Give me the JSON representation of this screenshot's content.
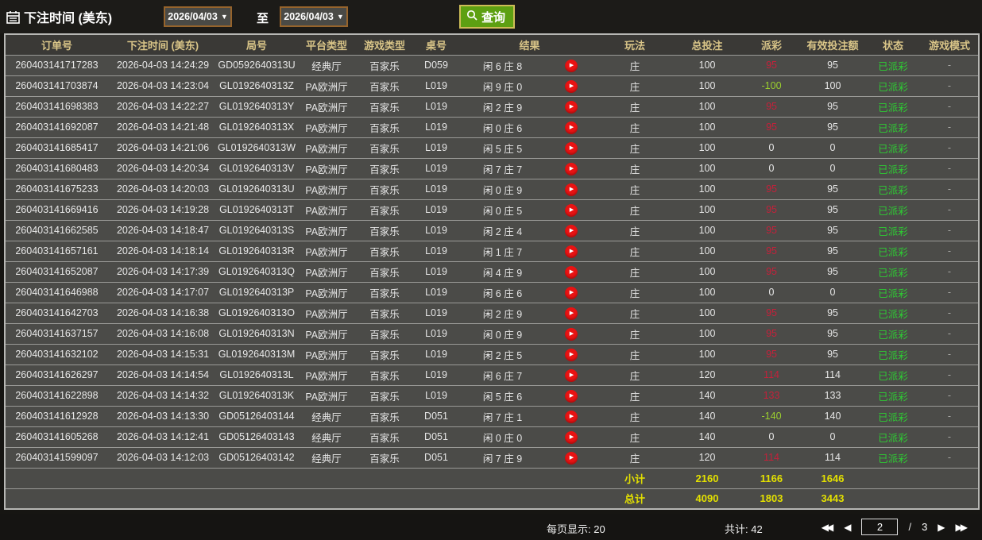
{
  "toolbar": {
    "label": "下注时间 (美东)",
    "date_from": "2026/04/03",
    "to_label": "至",
    "date_to": "2026/04/03",
    "search_label": "查询"
  },
  "table": {
    "columns": [
      "订单号",
      "下注时间 (美东)",
      "局号",
      "平台类型",
      "游戏类型",
      "桌号",
      "结果",
      "玩法",
      "总投注",
      "派彩",
      "有效投注额",
      "状态",
      "游戏模式"
    ],
    "rows": [
      {
        "order": "260403141717283",
        "time": "2026-04-03 14:24:29",
        "round": "GD0592640313U",
        "platform": "经典厅",
        "game": "百家乐",
        "table": "D059",
        "result": "闲 6 庄 8",
        "bet_type": "庄",
        "total": "100",
        "payout": "95",
        "payout_class": "payout-win",
        "valid": "95",
        "status": "已派彩",
        "mode": "-"
      },
      {
        "order": "260403141703874",
        "time": "2026-04-03 14:23:04",
        "round": "GL0192640313Z",
        "platform": "PA欧洲厅",
        "game": "百家乐",
        "table": "L019",
        "result": "闲 9 庄 0",
        "bet_type": "庄",
        "total": "100",
        "payout": "-100",
        "payout_class": "payout-loss",
        "valid": "100",
        "status": "已派彩",
        "mode": "-"
      },
      {
        "order": "260403141698383",
        "time": "2026-04-03 14:22:27",
        "round": "GL0192640313Y",
        "platform": "PA欧洲厅",
        "game": "百家乐",
        "table": "L019",
        "result": "闲 2 庄 9",
        "bet_type": "庄",
        "total": "100",
        "payout": "95",
        "payout_class": "payout-win",
        "valid": "95",
        "status": "已派彩",
        "mode": "-"
      },
      {
        "order": "260403141692087",
        "time": "2026-04-03 14:21:48",
        "round": "GL0192640313X",
        "platform": "PA欧洲厅",
        "game": "百家乐",
        "table": "L019",
        "result": "闲 0 庄 6",
        "bet_type": "庄",
        "total": "100",
        "payout": "95",
        "payout_class": "payout-win",
        "valid": "95",
        "status": "已派彩",
        "mode": "-"
      },
      {
        "order": "260403141685417",
        "time": "2026-04-03 14:21:06",
        "round": "GL0192640313W",
        "platform": "PA欧洲厅",
        "game": "百家乐",
        "table": "L019",
        "result": "闲 5 庄 5",
        "bet_type": "庄",
        "total": "100",
        "payout": "0",
        "payout_class": "payout-zero",
        "valid": "0",
        "status": "已派彩",
        "mode": "-"
      },
      {
        "order": "260403141680483",
        "time": "2026-04-03 14:20:34",
        "round": "GL0192640313V",
        "platform": "PA欧洲厅",
        "game": "百家乐",
        "table": "L019",
        "result": "闲 7 庄 7",
        "bet_type": "庄",
        "total": "100",
        "payout": "0",
        "payout_class": "payout-zero",
        "valid": "0",
        "status": "已派彩",
        "mode": "-"
      },
      {
        "order": "260403141675233",
        "time": "2026-04-03 14:20:03",
        "round": "GL0192640313U",
        "platform": "PA欧洲厅",
        "game": "百家乐",
        "table": "L019",
        "result": "闲 0 庄 9",
        "bet_type": "庄",
        "total": "100",
        "payout": "95",
        "payout_class": "payout-win",
        "valid": "95",
        "status": "已派彩",
        "mode": "-"
      },
      {
        "order": "260403141669416",
        "time": "2026-04-03 14:19:28",
        "round": "GL0192640313T",
        "platform": "PA欧洲厅",
        "game": "百家乐",
        "table": "L019",
        "result": "闲 0 庄 5",
        "bet_type": "庄",
        "total": "100",
        "payout": "95",
        "payout_class": "payout-win",
        "valid": "95",
        "status": "已派彩",
        "mode": "-"
      },
      {
        "order": "260403141662585",
        "time": "2026-04-03 14:18:47",
        "round": "GL0192640313S",
        "platform": "PA欧洲厅",
        "game": "百家乐",
        "table": "L019",
        "result": "闲 2 庄 4",
        "bet_type": "庄",
        "total": "100",
        "payout": "95",
        "payout_class": "payout-win",
        "valid": "95",
        "status": "已派彩",
        "mode": "-"
      },
      {
        "order": "260403141657161",
        "time": "2026-04-03 14:18:14",
        "round": "GL0192640313R",
        "platform": "PA欧洲厅",
        "game": "百家乐",
        "table": "L019",
        "result": "闲 1 庄 7",
        "bet_type": "庄",
        "total": "100",
        "payout": "95",
        "payout_class": "payout-win",
        "valid": "95",
        "status": "已派彩",
        "mode": "-"
      },
      {
        "order": "260403141652087",
        "time": "2026-04-03 14:17:39",
        "round": "GL0192640313Q",
        "platform": "PA欧洲厅",
        "game": "百家乐",
        "table": "L019",
        "result": "闲 4 庄 9",
        "bet_type": "庄",
        "total": "100",
        "payout": "95",
        "payout_class": "payout-win",
        "valid": "95",
        "status": "已派彩",
        "mode": "-"
      },
      {
        "order": "260403141646988",
        "time": "2026-04-03 14:17:07",
        "round": "GL0192640313P",
        "platform": "PA欧洲厅",
        "game": "百家乐",
        "table": "L019",
        "result": "闲 6 庄 6",
        "bet_type": "庄",
        "total": "100",
        "payout": "0",
        "payout_class": "payout-zero",
        "valid": "0",
        "status": "已派彩",
        "mode": "-"
      },
      {
        "order": "260403141642703",
        "time": "2026-04-03 14:16:38",
        "round": "GL0192640313O",
        "platform": "PA欧洲厅",
        "game": "百家乐",
        "table": "L019",
        "result": "闲 2 庄 9",
        "bet_type": "庄",
        "total": "100",
        "payout": "95",
        "payout_class": "payout-win",
        "valid": "95",
        "status": "已派彩",
        "mode": "-"
      },
      {
        "order": "260403141637157",
        "time": "2026-04-03 14:16:08",
        "round": "GL0192640313N",
        "platform": "PA欧洲厅",
        "game": "百家乐",
        "table": "L019",
        "result": "闲 0 庄 9",
        "bet_type": "庄",
        "total": "100",
        "payout": "95",
        "payout_class": "payout-win",
        "valid": "95",
        "status": "已派彩",
        "mode": "-"
      },
      {
        "order": "260403141632102",
        "time": "2026-04-03 14:15:31",
        "round": "GL0192640313M",
        "platform": "PA欧洲厅",
        "game": "百家乐",
        "table": "L019",
        "result": "闲 2 庄 5",
        "bet_type": "庄",
        "total": "100",
        "payout": "95",
        "payout_class": "payout-win",
        "valid": "95",
        "status": "已派彩",
        "mode": "-"
      },
      {
        "order": "260403141626297",
        "time": "2026-04-03 14:14:54",
        "round": "GL0192640313L",
        "platform": "PA欧洲厅",
        "game": "百家乐",
        "table": "L019",
        "result": "闲 6 庄 7",
        "bet_type": "庄",
        "total": "120",
        "payout": "114",
        "payout_class": "payout-win",
        "valid": "114",
        "status": "已派彩",
        "mode": "-"
      },
      {
        "order": "260403141622898",
        "time": "2026-04-03 14:14:32",
        "round": "GL0192640313K",
        "platform": "PA欧洲厅",
        "game": "百家乐",
        "table": "L019",
        "result": "闲 5 庄 6",
        "bet_type": "庄",
        "total": "140",
        "payout": "133",
        "payout_class": "payout-win",
        "valid": "133",
        "status": "已派彩",
        "mode": "-"
      },
      {
        "order": "260403141612928",
        "time": "2026-04-03 14:13:30",
        "round": "GD05126403144",
        "platform": "经典厅",
        "game": "百家乐",
        "table": "D051",
        "result": "闲 7 庄 1",
        "bet_type": "庄",
        "total": "140",
        "payout": "-140",
        "payout_class": "payout-loss",
        "valid": "140",
        "status": "已派彩",
        "mode": "-"
      },
      {
        "order": "260403141605268",
        "time": "2026-04-03 14:12:41",
        "round": "GD05126403143",
        "platform": "经典厅",
        "game": "百家乐",
        "table": "D051",
        "result": "闲 0 庄 0",
        "bet_type": "庄",
        "total": "140",
        "payout": "0",
        "payout_class": "payout-zero",
        "valid": "0",
        "status": "已派彩",
        "mode": "-"
      },
      {
        "order": "260403141599097",
        "time": "2026-04-03 14:12:03",
        "round": "GD05126403142",
        "platform": "经典厅",
        "game": "百家乐",
        "table": "D051",
        "result": "闲 7 庄 9",
        "bet_type": "庄",
        "total": "120",
        "payout": "114",
        "payout_class": "payout-win",
        "valid": "114",
        "status": "已派彩",
        "mode": "-"
      }
    ],
    "subtotal": {
      "label": "小计",
      "total": "2160",
      "payout": "1166",
      "valid": "1646"
    },
    "grand_total": {
      "label": "总计",
      "total": "4090",
      "payout": "1803",
      "valid": "3443"
    }
  },
  "footer": {
    "page_size_label": "每页显示: 20",
    "total_count_label": "共计: 42",
    "current_page": "2",
    "page_separator": "/",
    "total_pages": "3"
  },
  "colors": {
    "payout_win": "#c5203a",
    "payout_loss": "#9bcf2e",
    "status_paid": "#2ecc33",
    "summary_yellow": "#e3e000",
    "header_gold": "#d9c588",
    "search_green": "#5da012",
    "date_border": "#96642c",
    "play_red": "#e81313"
  }
}
